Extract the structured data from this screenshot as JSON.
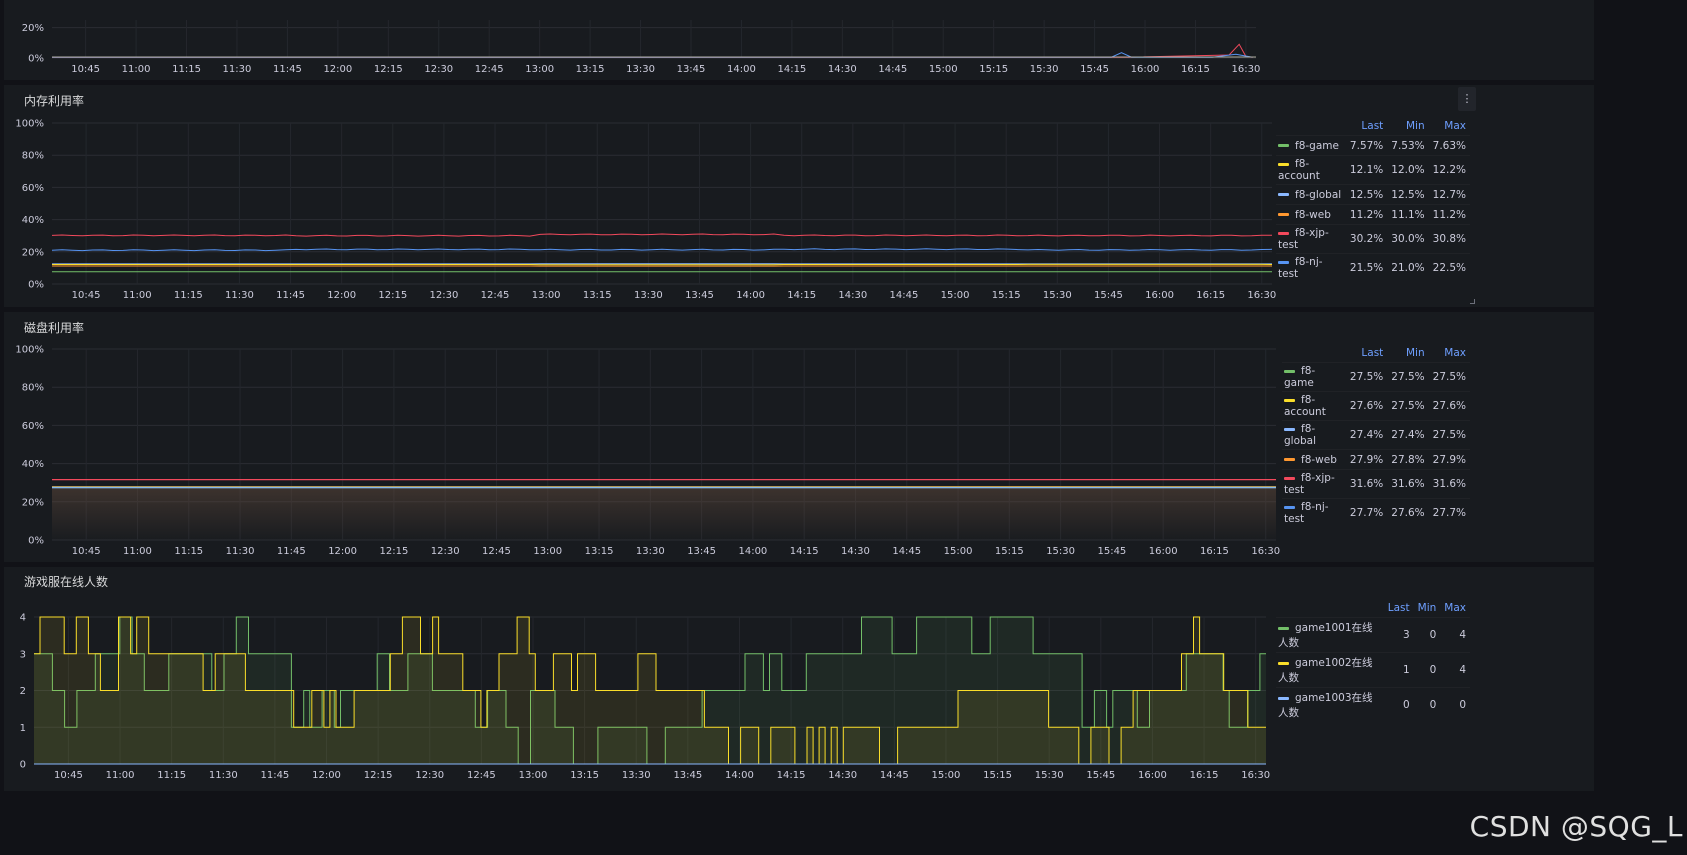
{
  "colors": {
    "green": "#73bf69",
    "yellow": "#fade2a",
    "lightblue": "#8ab8ff",
    "orange": "#ff9830",
    "red": "#f2495c",
    "blue": "#5794f2"
  },
  "x_ticks": [
    "10:45",
    "11:00",
    "11:15",
    "11:30",
    "11:45",
    "12:00",
    "12:15",
    "12:30",
    "12:45",
    "13:00",
    "13:15",
    "13:30",
    "13:45",
    "14:00",
    "14:15",
    "14:30",
    "14:45",
    "15:00",
    "15:15",
    "15:30",
    "15:45",
    "16:00",
    "16:15",
    "16:30"
  ],
  "panels": {
    "cpu": {
      "title": "",
      "y_ticks": [
        "0%",
        "20%"
      ]
    },
    "memory": {
      "title": "内存利用率",
      "y_ticks": [
        "0%",
        "20%",
        "40%",
        "60%",
        "80%",
        "100%"
      ],
      "menu_icon": "more-vertical-icon",
      "legend": {
        "headers": [
          "Last",
          "Min",
          "Max"
        ],
        "rows": [
          {
            "name": "f8-game",
            "color": "#73bf69",
            "last": "7.57%",
            "min": "7.53%",
            "max": "7.63%"
          },
          {
            "name": "f8-account",
            "color": "#fade2a",
            "last": "12.1%",
            "min": "12.0%",
            "max": "12.2%"
          },
          {
            "name": "f8-global",
            "color": "#8ab8ff",
            "last": "12.5%",
            "min": "12.5%",
            "max": "12.7%"
          },
          {
            "name": "f8-web",
            "color": "#ff9830",
            "last": "11.2%",
            "min": "11.1%",
            "max": "11.2%"
          },
          {
            "name": "f8-xjp-test",
            "color": "#f2495c",
            "last": "30.2%",
            "min": "30.0%",
            "max": "30.8%"
          },
          {
            "name": "f8-nj-test",
            "color": "#5794f2",
            "last": "21.5%",
            "min": "21.0%",
            "max": "22.5%"
          }
        ]
      }
    },
    "disk": {
      "title": "磁盘利用率",
      "y_ticks": [
        "0%",
        "20%",
        "40%",
        "60%",
        "80%",
        "100%"
      ],
      "legend": {
        "headers": [
          "Last",
          "Min",
          "Max"
        ],
        "rows": [
          {
            "name": "f8-game",
            "color": "#73bf69",
            "last": "27.5%",
            "min": "27.5%",
            "max": "27.5%"
          },
          {
            "name": "f8-account",
            "color": "#fade2a",
            "last": "27.6%",
            "min": "27.5%",
            "max": "27.6%"
          },
          {
            "name": "f8-global",
            "color": "#8ab8ff",
            "last": "27.4%",
            "min": "27.4%",
            "max": "27.5%"
          },
          {
            "name": "f8-web",
            "color": "#ff9830",
            "last": "27.9%",
            "min": "27.8%",
            "max": "27.9%"
          },
          {
            "name": "f8-xjp-test",
            "color": "#f2495c",
            "last": "31.6%",
            "min": "31.6%",
            "max": "31.6%"
          },
          {
            "name": "f8-nj-test",
            "color": "#5794f2",
            "last": "27.7%",
            "min": "27.6%",
            "max": "27.7%"
          }
        ]
      }
    },
    "players": {
      "title": "游戏服在线人数",
      "y_ticks": [
        "0",
        "1",
        "2",
        "3",
        "4"
      ],
      "legend": {
        "headers": [
          "Last",
          "Min",
          "Max"
        ],
        "rows": [
          {
            "name": "game1001在线人数",
            "color": "#73bf69",
            "last": "3",
            "min": "0",
            "max": "4"
          },
          {
            "name": "game1002在线人数",
            "color": "#fade2a",
            "last": "1",
            "min": "0",
            "max": "4"
          },
          {
            "name": "game1003在线人数",
            "color": "#8ab8ff",
            "last": "0",
            "min": "0",
            "max": "0"
          }
        ]
      }
    }
  },
  "chart_data": [
    {
      "type": "line",
      "title": "",
      "ylim": [
        0,
        25
      ],
      "series": [
        {
          "color": "#f2495c",
          "x": [
            "10:35",
            "15:55",
            "16:25",
            "16:28",
            "16:30",
            "16:32"
          ],
          "values": [
            0.5,
            0.5,
            2,
            9,
            1,
            0.5
          ]
        },
        {
          "color": "#5794f2",
          "x": [
            "10:35",
            "15:50",
            "15:53",
            "15:56",
            "16:20",
            "16:27",
            "16:32"
          ],
          "values": [
            0.5,
            0.5,
            3.5,
            0.5,
            0.5,
            2.5,
            0.5
          ]
        }
      ]
    },
    {
      "type": "line",
      "title": "内存利用率",
      "ylim": [
        0,
        100
      ],
      "series": [
        {
          "name": "f8-xjp-test",
          "color": "#f2495c",
          "values": [
            30.2,
            30.0,
            30.8,
            30.2,
            30.1,
            30.2
          ]
        },
        {
          "name": "f8-nj-test",
          "color": "#5794f2",
          "values": [
            21.0,
            21.5,
            21.3,
            21.6,
            21.2,
            21.5
          ]
        },
        {
          "name": "f8-global",
          "color": "#8ab8ff",
          "values": [
            12.5,
            12.5,
            12.6,
            12.5,
            12.5,
            12.5
          ]
        },
        {
          "name": "f8-account",
          "color": "#fade2a",
          "values": [
            12.1,
            12.1,
            12.0,
            12.1,
            12.2,
            12.1
          ]
        },
        {
          "name": "f8-web",
          "color": "#ff9830",
          "values": [
            11.2,
            11.2,
            11.1,
            11.2,
            11.2,
            11.2
          ]
        },
        {
          "name": "f8-game",
          "color": "#73bf69",
          "values": [
            7.57,
            7.55,
            7.6,
            7.57,
            7.58,
            7.57
          ]
        }
      ]
    },
    {
      "type": "area",
      "title": "磁盘利用率",
      "ylim": [
        0,
        100
      ],
      "series": [
        {
          "name": "f8-xjp-test",
          "color": "#f2495c",
          "values": [
            31.6,
            31.6,
            31.6,
            31.6,
            31.6,
            31.6
          ]
        },
        {
          "name": "f8-web",
          "color": "#ff9830",
          "values": [
            27.9,
            27.9,
            27.9,
            27.9,
            27.9,
            27.9
          ]
        },
        {
          "name": "f8-nj-test",
          "color": "#5794f2",
          "values": [
            27.7,
            27.7,
            27.7,
            27.7,
            27.6,
            27.7
          ]
        },
        {
          "name": "f8-account",
          "color": "#fade2a",
          "values": [
            27.6,
            27.6,
            27.6,
            27.6,
            27.6,
            27.6
          ]
        },
        {
          "name": "f8-game",
          "color": "#73bf69",
          "values": [
            27.5,
            27.5,
            27.5,
            27.5,
            27.5,
            27.5
          ]
        },
        {
          "name": "f8-global",
          "color": "#8ab8ff",
          "values": [
            27.4,
            27.4,
            27.4,
            27.4,
            27.4,
            27.4
          ]
        }
      ]
    },
    {
      "type": "area",
      "title": "游戏服在线人数",
      "ylim": [
        0,
        4
      ],
      "x_start": "10:35",
      "x_end": "16:32",
      "series": [
        {
          "name": "game1001在线人数",
          "color": "#73bf69",
          "values": [
            3,
            3,
            3,
            2,
            2,
            1,
            1,
            2,
            2,
            2,
            3,
            3,
            3,
            3,
            4,
            4,
            3,
            3,
            2,
            2,
            2,
            2,
            3,
            3,
            3,
            3,
            3,
            3,
            3,
            2,
            2,
            3,
            3,
            4,
            4,
            3,
            3,
            3,
            3,
            3,
            3,
            3,
            1,
            1,
            2,
            1,
            1,
            2,
            2,
            1,
            2,
            2,
            2,
            2,
            2,
            2,
            3,
            3,
            2,
            2,
            2,
            3,
            3,
            3,
            3,
            2,
            2,
            2,
            2,
            2,
            2,
            2,
            1,
            1,
            2,
            2,
            2,
            1,
            1,
            0,
            0,
            2,
            2,
            2,
            2,
            1,
            1,
            1,
            0,
            0,
            0,
            0,
            1,
            1,
            1,
            1,
            1,
            1,
            1,
            1,
            0,
            0,
            0,
            1,
            1,
            1,
            1,
            1,
            1,
            2,
            2,
            2,
            2,
            2,
            2,
            2,
            3,
            3,
            3,
            2,
            3,
            3,
            2,
            2,
            2,
            2,
            3,
            3,
            3,
            3,
            3,
            3,
            3,
            3,
            3,
            4,
            4,
            4,
            4,
            4,
            3,
            3,
            3,
            3,
            4,
            4,
            4,
            4,
            4,
            4,
            4,
            4,
            4,
            3,
            3,
            3,
            4,
            4,
            4,
            4,
            4,
            4,
            4,
            3,
            3,
            3,
            3,
            3,
            3,
            3,
            3,
            1,
            1,
            2,
            2,
            1,
            2,
            2,
            2,
            2,
            1,
            1,
            2,
            2,
            2,
            2,
            2,
            2,
            3,
            3,
            3,
            3,
            3,
            3,
            2,
            1,
            1,
            1,
            2,
            2,
            3
          ]
        },
        {
          "name": "game1002在线人数",
          "color": "#fade2a",
          "values": [
            3,
            4,
            4,
            4,
            4,
            3,
            3,
            4,
            4,
            3,
            3,
            2,
            2,
            2,
            4,
            4,
            3,
            4,
            4,
            3,
            3,
            3,
            3,
            3,
            3,
            3,
            3,
            3,
            2,
            2,
            3,
            3,
            3,
            3,
            3,
            2,
            2,
            2,
            2,
            2,
            2,
            2,
            2,
            1,
            1,
            1,
            2,
            2,
            1,
            2,
            1,
            1,
            1,
            2,
            2,
            2,
            2,
            2,
            2,
            3,
            3,
            4,
            4,
            4,
            3,
            3,
            4,
            3,
            3,
            3,
            3,
            2,
            2,
            2,
            1,
            2,
            2,
            3,
            3,
            3,
            4,
            4,
            3,
            2,
            2,
            2,
            3,
            3,
            3,
            2,
            3,
            3,
            3,
            2,
            2,
            2,
            2,
            2,
            2,
            2,
            3,
            3,
            3,
            2,
            2,
            2,
            2,
            2,
            2,
            2,
            2,
            1,
            1,
            1,
            1,
            0,
            0,
            1,
            1,
            1,
            0,
            0,
            1,
            1,
            1,
            1,
            0,
            0,
            1,
            0,
            1,
            0,
            1,
            0,
            1,
            1,
            1,
            1,
            1,
            1,
            0,
            0,
            0,
            1,
            1,
            1,
            1,
            1,
            1,
            1,
            1,
            1,
            1,
            2,
            2,
            2,
            2,
            2,
            2,
            2,
            2,
            2,
            2,
            2,
            2,
            2,
            2,
            2,
            1,
            1,
            1,
            1,
            1,
            0,
            0,
            1,
            1,
            1,
            0,
            0,
            1,
            1,
            2,
            2,
            2,
            2,
            2,
            2,
            2,
            2,
            3,
            3,
            4,
            3,
            3,
            3,
            3,
            2,
            2,
            2,
            2,
            1,
            1,
            1
          ]
        },
        {
          "name": "game1003在线人数",
          "color": "#8ab8ff",
          "values": [
            0,
            0
          ]
        }
      ]
    }
  ],
  "watermark": "CSDN @SQG_L"
}
